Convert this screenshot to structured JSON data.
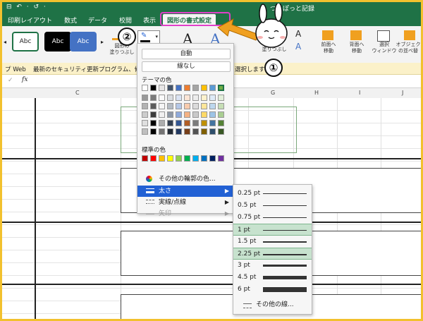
{
  "titlebar": {
    "quick_access": "⊟ ↶ · ↺ ·",
    "doc_title": "ついぽっと記録"
  },
  "tabs": [
    {
      "label": "印刷レイアウト"
    },
    {
      "label": "数式"
    },
    {
      "label": "データ"
    },
    {
      "label": "校閲"
    },
    {
      "label": "表示"
    },
    {
      "label": "図形の書式設定"
    }
  ],
  "ribbon": {
    "style_label": "Abc",
    "fill_label": "図形の\n塗りつぶし",
    "text_label": "文字の\n塗りつぶし",
    "bring_forward": "前面へ\n移動",
    "send_backward": "背面へ\n移動",
    "selection_pane": "選択\nウィンドウ",
    "arrange": "オブジェク\nの並べ替"
  },
  "infobar": {
    "label": "プ Web",
    "message": "最新のセキュリティ更新プログラム、修",
    "tail": "選択します"
  },
  "formula": {
    "fx": "fx",
    "check": "✓"
  },
  "columns": [
    "C",
    "G",
    "H",
    "I",
    "J"
  ],
  "popup": {
    "auto": "自動",
    "none": "線なし",
    "theme_colors": "テーマの色",
    "standard_colors": "標準の色",
    "more_colors": "その他の輪郭の色...",
    "weight": "太さ",
    "dashes": "実線/点線",
    "arrows": "矢印"
  },
  "theme_top": [
    "#ffffff",
    "#000000",
    "#e7e6e6",
    "#44546a",
    "#4472c4",
    "#ed7d31",
    "#a5a5a5",
    "#ffc000",
    "#5b9bd5",
    "#70ad47"
  ],
  "standard": [
    "#c00000",
    "#ff0000",
    "#ffc000",
    "#ffff00",
    "#92d050",
    "#00b050",
    "#00b0f0",
    "#0070c0",
    "#002060",
    "#7030a0"
  ],
  "weights": [
    {
      "label": "0.25 pt",
      "w": 0.25
    },
    {
      "label": "0.5 pt",
      "w": 0.5
    },
    {
      "label": "0.75 pt",
      "w": 0.75
    },
    {
      "label": "1 pt",
      "w": 1
    },
    {
      "label": "1.5 pt",
      "w": 1.5
    },
    {
      "label": "2.25 pt",
      "w": 2.25
    },
    {
      "label": "3 pt",
      "w": 3
    },
    {
      "label": "4.5 pt",
      "w": 4.5
    },
    {
      "label": "6 pt",
      "w": 6
    }
  ],
  "more_lines": "その他の線...",
  "callouts": {
    "one": "①",
    "two": "②"
  },
  "colors": {
    "excel_green": "#1f7246",
    "highlight": "#c7e2ce",
    "menu_select": "#2261d4",
    "border": "#f2c12e",
    "ring": "#e040c8",
    "arrow": "#f0a020"
  }
}
